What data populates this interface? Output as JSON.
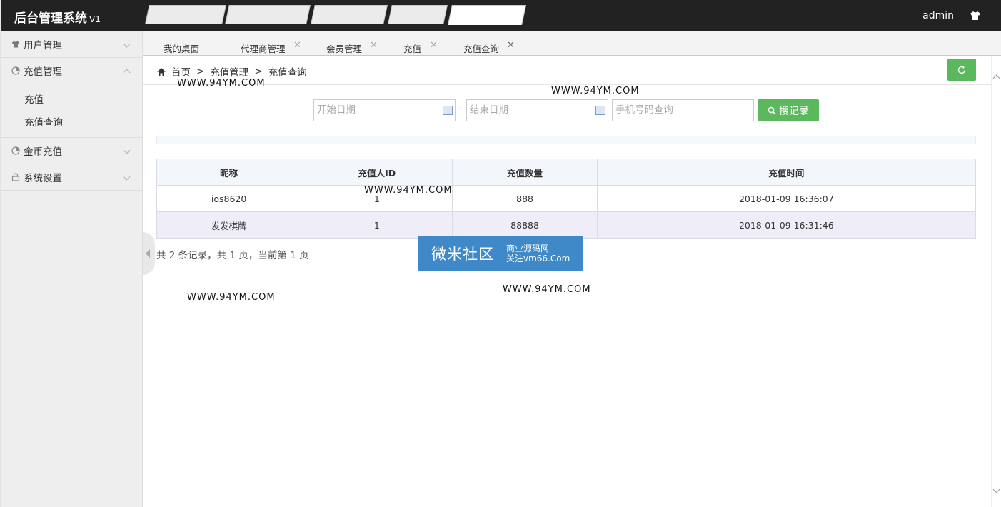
{
  "header": {
    "title": "后台管理系统",
    "version": "V1",
    "username": "admin"
  },
  "sidebar": {
    "items": [
      {
        "label": "用户管理",
        "icon": "shirt-icon",
        "expanded": false
      },
      {
        "label": "充值管理",
        "icon": "pie-icon",
        "expanded": true,
        "children": [
          "充值",
          "充值查询"
        ]
      },
      {
        "label": "金币充值",
        "icon": "pie-icon",
        "expanded": false
      },
      {
        "label": "系统设置",
        "icon": "lock-icon",
        "expanded": false
      }
    ]
  },
  "tabs": [
    {
      "label": "我的桌面",
      "closable": false
    },
    {
      "label": "代理商管理",
      "closable": true
    },
    {
      "label": "会员管理",
      "closable": true
    },
    {
      "label": "充值",
      "closable": true
    },
    {
      "label": "充值查询",
      "closable": true,
      "active": true
    }
  ],
  "breadcrumb": {
    "home": "首页",
    "sep": ">",
    "level1": "充值管理",
    "level2": "充值查询"
  },
  "filters": {
    "start_placeholder": "开始日期",
    "dash": "-",
    "end_placeholder": "结束日期",
    "phone_placeholder": "手机号码查询",
    "search_label": "搜记录"
  },
  "table": {
    "headers": [
      "昵称",
      "充值人ID",
      "充值数量",
      "充值时间"
    ],
    "rows": [
      [
        "ios8620",
        "1",
        "888",
        "2018-01-09 16:36:07"
      ],
      [
        "发发棋牌",
        "1",
        "88888",
        "2018-01-09 16:31:46"
      ]
    ]
  },
  "pager": "共 2 条记录，共 1 页，当前第 1 页",
  "watermarks": {
    "w1": "WWW.94YM.COM",
    "w2": "WWW.94YM.COM",
    "w3": "WWW.94YM.COM",
    "w4": "WWW.94YM.COM",
    "w5": "WWW.94YM.COM"
  },
  "banner": {
    "big": "微米社区",
    "line1": "商业源码网",
    "line2": "关注vm66.Com",
    "color": "#3f89c9"
  },
  "colors": {
    "accent_green": "#5cb85c",
    "topbar": "#222222"
  }
}
